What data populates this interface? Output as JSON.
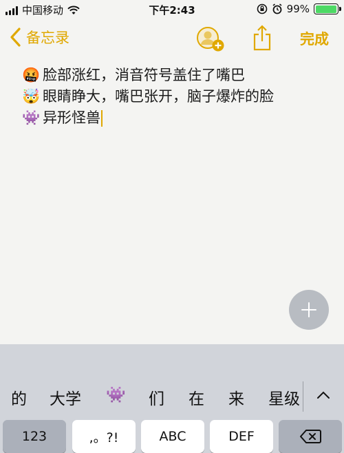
{
  "status_bar": {
    "carrier": "中国移动",
    "time": "下午2:43",
    "battery_percent": "99%",
    "battery_level": 0.99,
    "colors": {
      "battery_fill": "#4cd964"
    }
  },
  "nav": {
    "back_label": "备忘录",
    "done_label": "完成",
    "accent_color": "#e0a800",
    "icons": [
      "chevron-left-icon",
      "add-contact-icon",
      "share-icon"
    ]
  },
  "note": {
    "lines": [
      {
        "emoji": "🤬",
        "text": "脸部涨红，消音符号盖住了嘴巴"
      },
      {
        "emoji": "🤯",
        "text": "眼睛睁大，嘴巴张开，脑子爆炸的脸"
      },
      {
        "emoji": "👾",
        "text": "异形怪兽"
      }
    ]
  },
  "fab": {
    "icon": "plus-icon"
  },
  "keyboard": {
    "candidates": [
      "的",
      "大学",
      "👾",
      "们",
      "在",
      "来",
      "星级"
    ],
    "keys": [
      "123",
      ",。?!",
      "ABC",
      "DEF"
    ],
    "delete_icon": "backspace-icon",
    "expand_icon": "chevron-up-icon"
  }
}
